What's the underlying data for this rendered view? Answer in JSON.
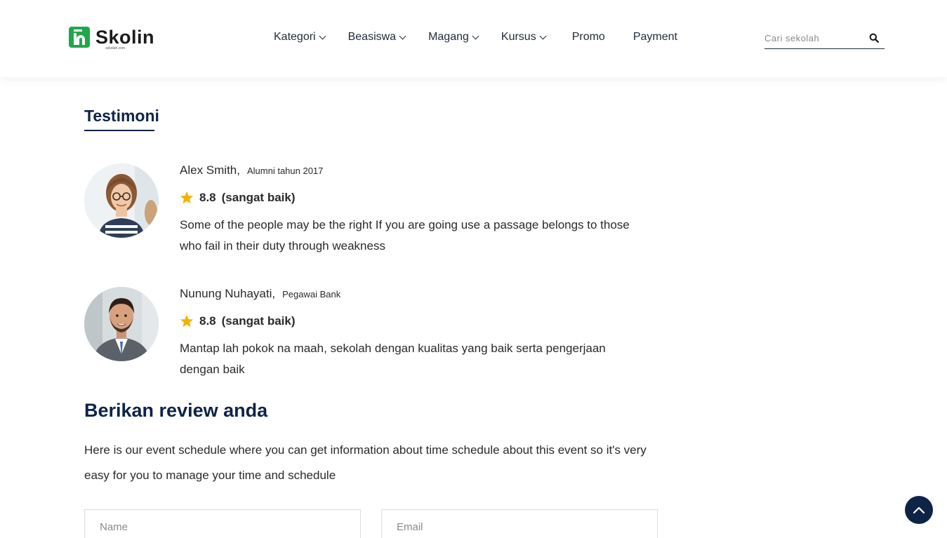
{
  "brand": {
    "name": "Skolin",
    "tagline": "sekolah.com"
  },
  "nav": {
    "items": [
      {
        "label": "Kategori",
        "dropdown": true
      },
      {
        "label": "Beasiswa",
        "dropdown": true
      },
      {
        "label": "Magang",
        "dropdown": true
      },
      {
        "label": "Kursus",
        "dropdown": true
      },
      {
        "label": "Promo",
        "dropdown": false
      },
      {
        "label": "Payment",
        "dropdown": false
      }
    ]
  },
  "search": {
    "placeholder": "Cari sekolah",
    "icon": "search-icon"
  },
  "testimoni": {
    "title": "Testimoni",
    "items": [
      {
        "name": "Alex Smith,",
        "role": "Alumni tahun 2017",
        "score": "8.8",
        "score_label": "(sangat baik)",
        "text": "Some of the people may be the right If you are going use a passage belongs to those who fail in their duty through weakness"
      },
      {
        "name": "Nunung Nuhayati,",
        "role": "Pegawai Bank",
        "score": "8.8",
        "score_label": "(sangat baik)",
        "text": "Mantap lah pokok na maah, sekolah dengan kualitas yang baik serta pengerjaan dengan baik"
      }
    ]
  },
  "review": {
    "title": "Berikan review anda",
    "description": "Here is our event schedule where you can get information about time schedule about this event so it's very easy for you to manage your time and schedule",
    "name_placeholder": "Name",
    "email_placeholder": "Email"
  },
  "colors": {
    "brand_green": "#1fa74a",
    "heading_navy": "#0d2447",
    "star_yellow": "#f5b301"
  }
}
